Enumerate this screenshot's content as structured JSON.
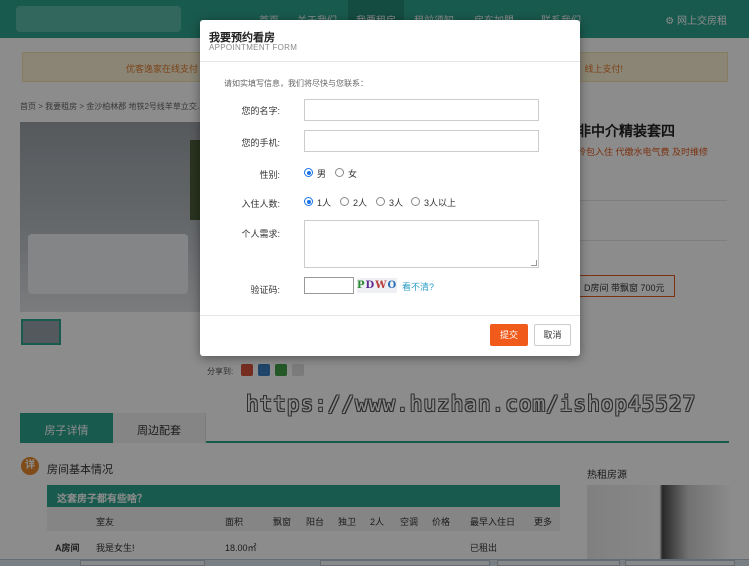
{
  "nav": {
    "items": [
      "首页",
      "关于我们",
      "我要租房",
      "租前须知",
      "房东加盟",
      "联系我们"
    ],
    "active_index": 2,
    "right_link": "网上交房租"
  },
  "notice": {
    "left": "优客逸家在线支付",
    "right": "线上支付!"
  },
  "breadcrumb": "首页  >  我要租房  >  金沙柏林郡 地铁2号线羊草立交...",
  "listing": {
    "title": "非中介精装套四",
    "subtitle": "拎包入住 代缴水电气费 及时维修",
    "price_tag": "D房间 带飘窗 700元"
  },
  "share_label": "分享到:",
  "watermark": "https://www.huzhan.com/ishop45527",
  "tabs": [
    "房子详情",
    "周边配套"
  ],
  "detail": {
    "icon": "详",
    "title": "房间基本情况",
    "banner": "这套房子都有些啥？",
    "headers": [
      "室友",
      "面积",
      "飘窗",
      "阳台",
      "独卫",
      "2人",
      "空调",
      "价格",
      "最早入住日",
      "更多"
    ],
    "row": {
      "room": "A房间",
      "roommate": "我是女生!",
      "area": "18.00㎡",
      "status": "已租出"
    }
  },
  "hot": {
    "title": "热租房源"
  },
  "modal": {
    "title": "我要预约看房",
    "subtitle": "APPOINTMENT FORM",
    "intro": "请如实填写信息，我们将尽快与您联系：",
    "name_label": "您的名字:",
    "phone_label": "您的手机:",
    "gender_label": "性别:",
    "gender_options": [
      "男",
      "女"
    ],
    "gender_selected": 0,
    "people_label": "入住人数:",
    "people_options": [
      "1人",
      "2人",
      "3人",
      "3人以上"
    ],
    "people_selected": 0,
    "needs_label": "个人需求:",
    "captcha_label": "验证码:",
    "captcha_chars": [
      "P",
      "D",
      "W",
      "O"
    ],
    "refresh_text": "看不清?",
    "submit": "提交",
    "cancel": "取消"
  },
  "colors": {
    "brand": "#2fa58f",
    "accent": "#f05a1a",
    "link": "#2a9ec7"
  }
}
